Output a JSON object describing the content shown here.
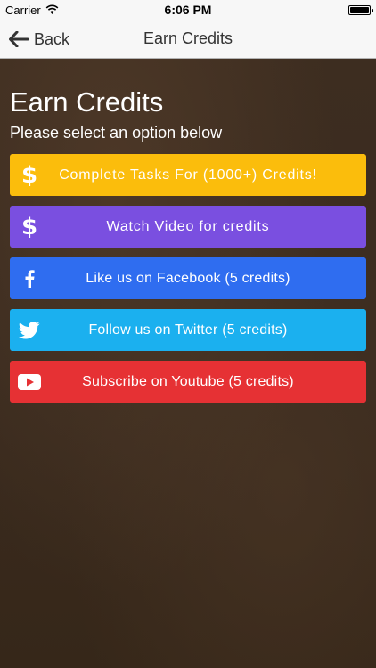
{
  "status": {
    "carrier": "Carrier",
    "time": "6:06 PM"
  },
  "nav": {
    "back_label": "Back",
    "title": "Earn Credits"
  },
  "page": {
    "heading": "Earn Credits",
    "subheading": "Please select an option below"
  },
  "options": [
    {
      "label": "Complete Tasks For (1000+) Credits!",
      "icon": "dollar-icon",
      "color": "#fbbd0c"
    },
    {
      "label": "Watch Video for credits",
      "icon": "dollar-icon",
      "color": "#7a4fe0"
    },
    {
      "label": "Like us on Facebook (5 credits)",
      "icon": "facebook-icon",
      "color": "#2f6df0"
    },
    {
      "label": "Follow us on Twitter (5 credits)",
      "icon": "twitter-icon",
      "color": "#1bb0ef"
    },
    {
      "label": "Subscribe on Youtube (5 credits)",
      "icon": "youtube-icon",
      "color": "#e63134"
    }
  ]
}
